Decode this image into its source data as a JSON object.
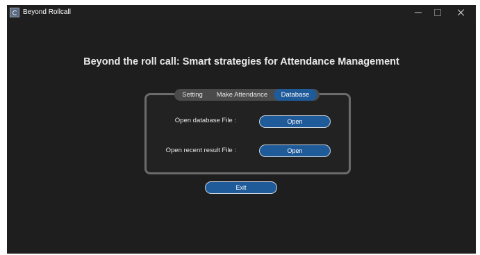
{
  "window": {
    "title": "Beyond Rollcall",
    "controls": {
      "minimize": "minimize",
      "maximize": "maximize",
      "close": "close"
    }
  },
  "headline": "Beyond the roll call: Smart strategies for Attendance Management",
  "tabs": [
    {
      "label": "Setting",
      "selected": false
    },
    {
      "label": "Make Attendance",
      "selected": false
    },
    {
      "label": "Database",
      "selected": true
    }
  ],
  "database_tab": {
    "open_db_label": "Open database File :",
    "open_db_button": "Open",
    "open_recent_label": "Open recent result File :",
    "open_recent_button": "Open"
  },
  "exit_button": "Exit",
  "colors": {
    "background": "#1e1e1e",
    "accent": "#1f5a99",
    "tabbar": "#4a4a4a",
    "panel_border": "#6b6b6b"
  },
  "icons": [
    "app-icon",
    "minimize-icon",
    "maximize-icon",
    "close-icon"
  ]
}
